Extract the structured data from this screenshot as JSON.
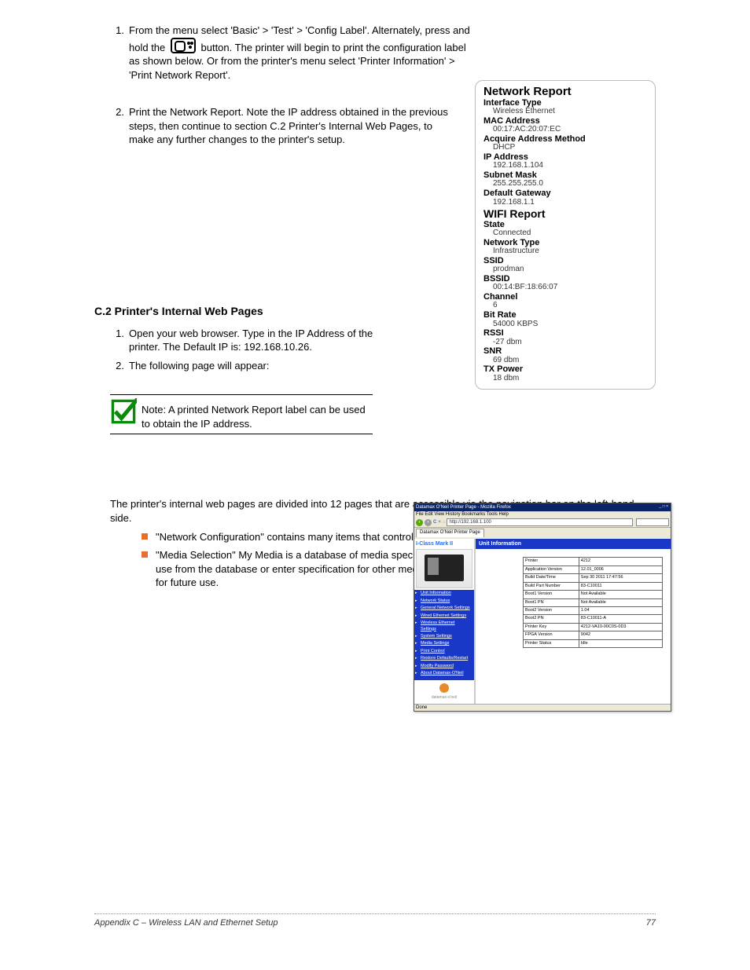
{
  "steps_top": [
    {
      "n": "1.",
      "text_before": "From the menu select 'Basic' > 'Test' > 'Config Label'. Alternately, press and hold the ",
      "text_after": " button. The printer will begin to print the configuration label as shown below. Or from the printer's menu select 'Printer Information' > 'Print Network Report'."
    }
  ],
  "steps_top2": {
    "n": "2.",
    "text": "Print the Network Report. Note the IP address obtained in the previous steps, then continue to section C.2 Printer's Internal Web Pages, to make any further changes to the printer's setup."
  },
  "report": {
    "title1": "Network Report",
    "rows1": [
      {
        "k": "Interface Type",
        "v": "Wireless Ethernet"
      },
      {
        "k": "MAC Address",
        "v": "00:17:AC:20:07:EC"
      },
      {
        "k": "Acquire Address Method",
        "v": "DHCP"
      },
      {
        "k": "IP Address",
        "v": "192.168.1.104"
      },
      {
        "k": "Subnet Mask",
        "v": "255.255.255.0"
      },
      {
        "k": "Default Gateway",
        "v": "192.168.1.1"
      }
    ],
    "title2": "WIFI Report",
    "rows2": [
      {
        "k": "State",
        "v": "Connected"
      },
      {
        "k": "Network Type",
        "v": "Infrastructure"
      },
      {
        "k": "SSID",
        "v": "prodman"
      },
      {
        "k": "BSSID",
        "v": "00:14:BF:18:66:07"
      },
      {
        "k": "Channel",
        "v": "6"
      },
      {
        "k": "Bit Rate",
        "v": "54000 KBPS"
      },
      {
        "k": "RSSI",
        "v": "-27 dbm"
      },
      {
        "k": "SNR",
        "v": "69 dbm"
      },
      {
        "k": "TX Power",
        "v": "18 dbm"
      }
    ]
  },
  "c2": {
    "heading": "C.2 Printer's Internal Web Pages",
    "p1_n": "1.",
    "p1": "Open your web browser. Type in the IP Address of the printer. The Default IP is: 192.168.10.26.",
    "p2_n": "2.",
    "p2": "The following page will appear:",
    "note": "Note: A printed Network Report label can be used to obtain the IP address.",
    "p3": "The printer's internal web pages are divided into 12 pages that are accessible via the navigation bar on the left-hand side.",
    "bullets": [
      "\"Network Configuration\" contains many items that control the connection and communication to the host.",
      "\"Media Selection\" My Media is a database of media specifications. Users can select media for the printer to use from the database or enter specification for other media. The other media can be saved to the database for future use."
    ]
  },
  "browser": {
    "title": "Datamax O'Neil Printer Page - Mozilla Firefox",
    "menu": "File  Edit  View  History  Bookmarks  Tools  Help",
    "addr": "http://192.168.1.100",
    "tab": "Datamax O'Neil Printer Page",
    "model": "I-Class Mark II",
    "nav": [
      "Unit Information",
      "Network Status",
      "General Network Settings",
      "Wired Ethernet Settings",
      "Wireless Ethernet Settings",
      "System Settings",
      "Media Settings",
      "Print Control",
      "Restore Defaults/Restart",
      "Modify Password",
      "About Datamax-O'Neil"
    ],
    "logo": "datamax-o'neil",
    "unit_header": "Unit Information",
    "table": [
      [
        "Printer",
        "4212"
      ],
      [
        "Application Version",
        "12.01_0006"
      ],
      [
        "Build Date/Time",
        "Sep 30 2011  17:47:56"
      ],
      [
        "Build Part Number",
        "83-C10011"
      ],
      [
        "Boot1 Version",
        "Not Available"
      ],
      [
        "Boot1 PN",
        "Not Available"
      ],
      [
        "Boot2 Version",
        "1.04"
      ],
      [
        "Boot2 PN",
        "83-C10011-A"
      ],
      [
        "Printer Key",
        "4212-VA10-00C0S-0D3"
      ],
      [
        "FPGA Version",
        "9042"
      ],
      [
        "Printer Status",
        "Idle"
      ]
    ],
    "status": "Done"
  },
  "footer": {
    "left": "Appendix C – Wireless LAN and Ethernet Setup",
    "right": "77"
  }
}
